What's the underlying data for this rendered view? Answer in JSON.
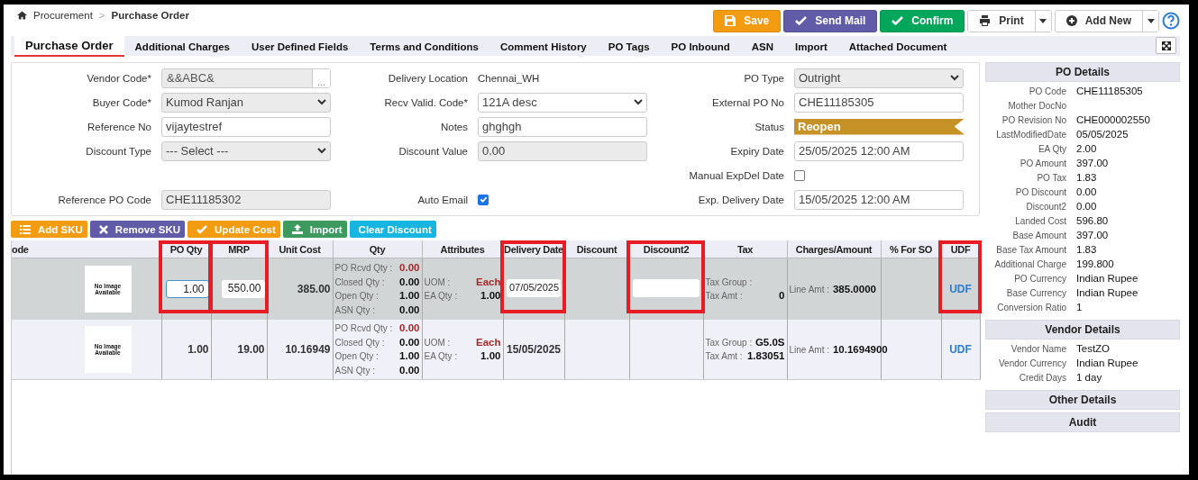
{
  "breadcrumb": [
    "Procurement",
    "Purchase Order"
  ],
  "breadcrumb_separator": ">",
  "actions": [
    {
      "label": "Save",
      "kind": "save"
    },
    {
      "label": "Send Mail",
      "kind": "mail"
    },
    {
      "label": "Confirm",
      "kind": "confirm"
    },
    {
      "label": "Print",
      "kind": "print"
    },
    {
      "label": "Add New",
      "kind": "add"
    }
  ],
  "tabs": [
    {
      "label": "Purchase Order",
      "selected": true
    },
    {
      "label": "Additional Charges",
      "selected": false
    },
    {
      "label": "User Defined Fields",
      "selected": false
    },
    {
      "label": "Terms and Conditions",
      "selected": false
    },
    {
      "label": "Comment History",
      "selected": false
    },
    {
      "label": "PO Tags",
      "selected": false
    },
    {
      "label": "PO Inbound",
      "selected": false
    },
    {
      "label": "ASN",
      "selected": false
    },
    {
      "label": "Import",
      "selected": false
    },
    {
      "label": "Attached Document",
      "selected": false
    }
  ],
  "form_rows": [
    {
      "left": {
        "label": "Vendor Code*",
        "kind": "lookup",
        "value": "&&ABC&",
        "button": "...",
        "disabled": true
      },
      "middle": {
        "label": "Delivery Location",
        "kind": "text",
        "value": "Chennai_WH"
      },
      "right": {
        "label": "PO Type",
        "kind": "select",
        "value": "Outright",
        "disabled": true
      }
    },
    {
      "left": {
        "label": "Buyer Code*",
        "kind": "select",
        "value": "Kumod Ranjan",
        "disabled": true
      },
      "middle": {
        "label": "Recv Valid. Code*",
        "kind": "select",
        "value": "121A desc",
        "disabled": false
      },
      "right": {
        "label": "External PO No",
        "kind": "input",
        "value": "CHE11185305",
        "disabled": false
      }
    },
    {
      "left": {
        "label": "Reference No",
        "kind": "input",
        "value": "vijaytestref",
        "disabled": false
      },
      "middle": {
        "label": "Notes",
        "kind": "textarea",
        "value": "ghghgh",
        "disabled": false
      },
      "right": {
        "label": "Status",
        "kind": "status",
        "value": "Reopen"
      }
    },
    {
      "left": {
        "label": "Discount Type",
        "kind": "select",
        "value": "--- Select ---",
        "disabled": true
      },
      "middle": {
        "label": "Discount Value",
        "kind": "input",
        "value": "0.00",
        "disabled": true
      },
      "right": {
        "label": "Expiry Date",
        "kind": "input",
        "value": "25/05/2025 12:00 AM",
        "disabled": false
      }
    },
    {
      "right": {
        "label": "Manual ExpDel Date",
        "kind": "checkbox",
        "checked": false
      }
    },
    {
      "left": {
        "label": "Reference PO Code",
        "kind": "input",
        "value": "CHE11185302",
        "disabled": true
      },
      "middle": {
        "label": "Auto Email",
        "kind": "checkbox",
        "checked": true
      },
      "right": {
        "label": "Exp. Delivery Date",
        "kind": "input",
        "value": "15/05/2025 12:00 AM",
        "disabled": false
      }
    }
  ],
  "sku_actions": [
    {
      "label": "Add SKU",
      "kind": "add"
    },
    {
      "label": "Remove SKU",
      "kind": "remove"
    },
    {
      "label": "Update Cost",
      "kind": "update"
    },
    {
      "label": "Import",
      "kind": "import"
    },
    {
      "label": "Clear Discount",
      "kind": "clear"
    }
  ],
  "columns": [
    {
      "label": "ode",
      "highlighted": false
    },
    {
      "label": "PO Qty",
      "highlighted": true
    },
    {
      "label": "MRP",
      "highlighted": true
    },
    {
      "label": "Unit Cost",
      "highlighted": false
    },
    {
      "label": "Qty",
      "highlighted": false
    },
    {
      "label": "Attributes",
      "highlighted": false
    },
    {
      "label": "Delivery Date",
      "highlighted": true
    },
    {
      "label": "Discount",
      "highlighted": false
    },
    {
      "label": "Discount2",
      "highlighted": true
    },
    {
      "label": "Tax",
      "highlighted": false
    },
    {
      "label": "Charges/Amount",
      "highlighted": false
    },
    {
      "label": "% For SO",
      "highlighted": false
    },
    {
      "label": "UDF",
      "highlighted": true
    }
  ],
  "rows": [
    {
      "selected": true,
      "image_text": "No Image Available",
      "po_qty": "1.00",
      "mrp": "550.00",
      "unit_cost": "385.00",
      "qty": [
        {
          "label": "PO Rcvd Qty :",
          "value": "0.00",
          "alert": true
        },
        {
          "label": "Closed Qty :",
          "value": "0.00",
          "alert": false
        },
        {
          "label": "Open Qty :",
          "value": "1.00",
          "alert": false
        },
        {
          "label": "ASN Qty :",
          "value": "0.00",
          "alert": false
        }
      ],
      "uom_label": "UOM :",
      "uom": "Each",
      "ea_label": "EA Qty :",
      "ea_qty": "1.00",
      "delivery_date": "07/05/2025",
      "tax_group_label": "Tax Group :",
      "tax_amt_label": "Tax Amt :",
      "tax_amt": "0",
      "line_amt_label": "Line Amt :",
      "line_amt": "385.0000",
      "udf": "UDF"
    },
    {
      "selected": false,
      "image_text": "No Image Available",
      "po_qty": "1.00",
      "mrp": "19.00",
      "unit_cost": "10.16949",
      "qty": [
        {
          "label": "PO Rcvd Qty :",
          "value": "0.00",
          "alert": true
        },
        {
          "label": "Closed Qty :",
          "value": "0.00",
          "alert": false
        },
        {
          "label": "Open Qty :",
          "value": "1.00",
          "alert": false
        },
        {
          "label": "ASN Qty :",
          "value": "0.00",
          "alert": false
        }
      ],
      "uom_label": "UOM :",
      "uom": "Each",
      "ea_label": "EA Qty :",
      "ea_qty": "1.00",
      "delivery_date": "15/05/2025",
      "tax_group_label": "Tax Group :",
      "tax_group": "G5.0S",
      "tax_amt_label": "Tax Amt :",
      "tax_amt": "1.83051",
      "line_amt_label": "Line Amt :",
      "line_amt": "10.1694900",
      "udf": "UDF"
    }
  ],
  "side_sections": [
    {
      "title": "PO Details",
      "rows": [
        {
          "label": "PO Code",
          "value": "CHE11185305"
        },
        {
          "label": "Mother DocNo"
        },
        {
          "label": "PO Revision No",
          "value": "CHE000002550"
        },
        {
          "label": "LastModifiedDate",
          "value": "05/05/2025"
        },
        {
          "label": "EA Qty",
          "value": "2.00"
        },
        {
          "label": "PO Amount",
          "value": "397.00"
        },
        {
          "label": "PO Tax",
          "value": "1.83"
        },
        {
          "label": "PO Discount",
          "value": "0.00"
        },
        {
          "label": "Discount2",
          "value": "0.00"
        },
        {
          "label": "Landed Cost",
          "value": "596.80"
        },
        {
          "label": "Base Amount",
          "value": "397.00"
        },
        {
          "label": "Base Tax Amount",
          "value": "1.83"
        },
        {
          "label": "Additional Charge",
          "value": "199.800"
        },
        {
          "label": "PO Currency",
          "value": "Indian Rupee"
        },
        {
          "label": "Base Currency",
          "value": "Indian Rupee"
        },
        {
          "label": "Conversion Ratio",
          "value": "1"
        }
      ]
    },
    {
      "title": "Vendor Details",
      "rows": [
        {
          "label": "Vendor Name",
          "value": "TestZO"
        },
        {
          "label": "Vendor Currency",
          "value": "Indian Rupee"
        },
        {
          "label": "Credit Days",
          "value": "1 day"
        }
      ]
    },
    {
      "title": "Other Details"
    },
    {
      "title": "Audit"
    }
  ]
}
